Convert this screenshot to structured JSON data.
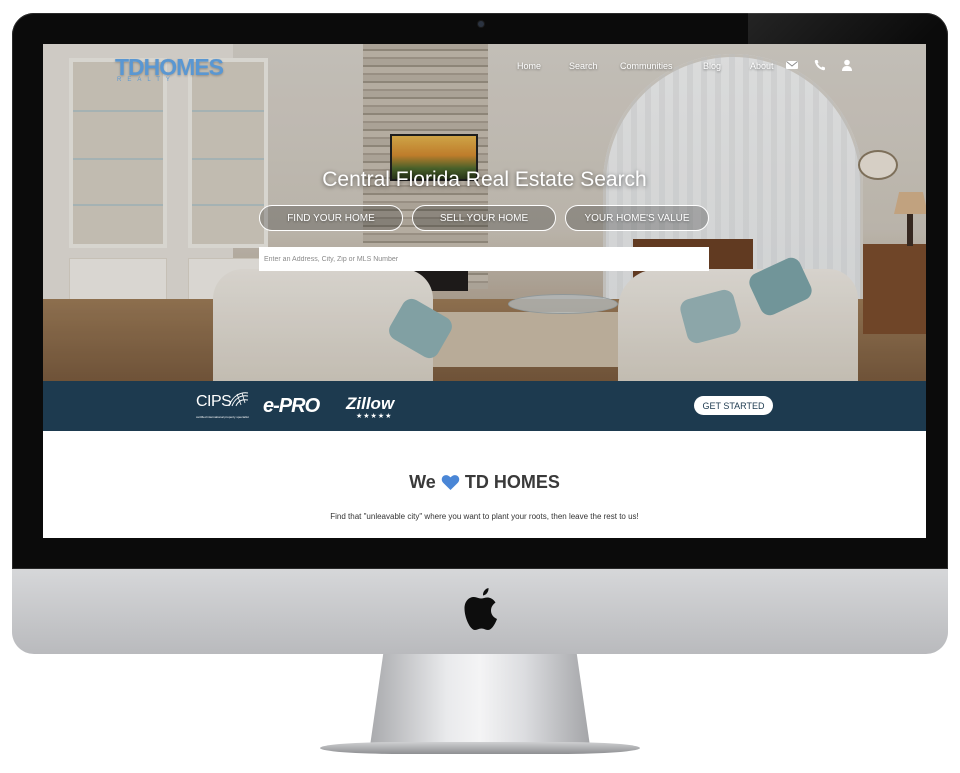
{
  "site": {
    "logo_text": "TDHOMES",
    "logo_sub": "REALTY",
    "accent_color": "#5a97d2",
    "bar_color": "#1d3a4f"
  },
  "nav": {
    "items": [
      {
        "label": "Home"
      },
      {
        "label": "Search"
      },
      {
        "label": "Communities"
      },
      {
        "label": "Blog"
      },
      {
        "label": "About"
      }
    ],
    "icons": [
      "envelope-icon",
      "phone-icon",
      "user-icon"
    ]
  },
  "hero": {
    "title": "Central Florida Real Estate Search",
    "buttons": [
      {
        "label": "FIND YOUR HOME"
      },
      {
        "label": "SELL YOUR HOME"
      },
      {
        "label": "YOUR HOME'S VALUE"
      }
    ],
    "search_placeholder": "Enter an Address, City, Zip or MLS Number"
  },
  "badges": {
    "cips": "CIPS",
    "cips_sub": "certified international property specialist",
    "epro": "e-PRO",
    "zillow": "Zillow",
    "zillow_stars": "★★★★★",
    "cta_label": "GET STARTED"
  },
  "intro": {
    "title_before": "We",
    "title_after": "TD HOMES",
    "tagline": "Find that \"unleavable city\" where you want to plant your roots, then leave the rest to us!"
  }
}
